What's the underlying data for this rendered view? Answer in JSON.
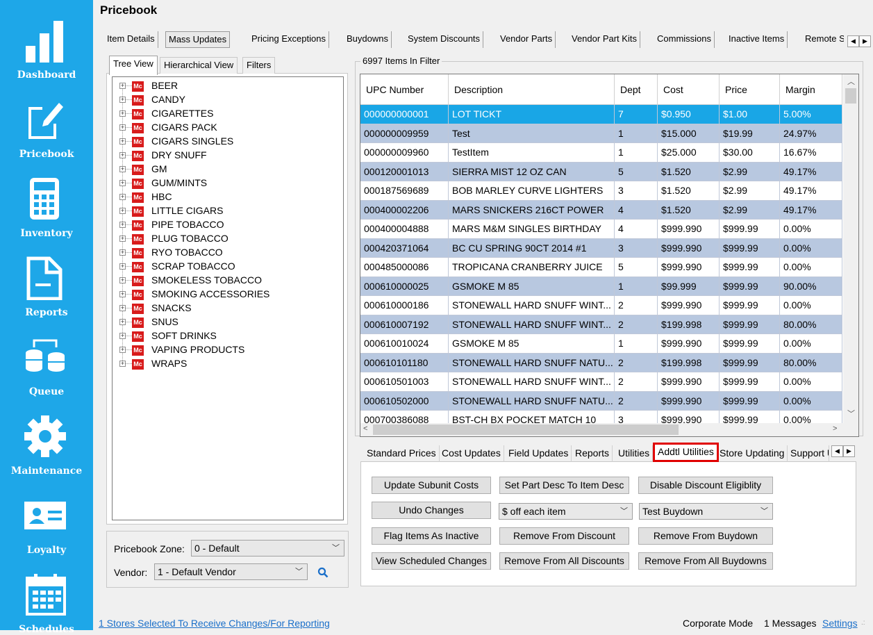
{
  "sidebar": {
    "items": [
      {
        "label": "Dashboard",
        "icon": "bar-chart-icon"
      },
      {
        "label": "Pricebook",
        "icon": "edit-document-icon"
      },
      {
        "label": "Inventory",
        "icon": "calculator-icon"
      },
      {
        "label": "Reports",
        "icon": "report-document-icon"
      },
      {
        "label": "Queue",
        "icon": "database-sync-icon"
      },
      {
        "label": "Maintenance",
        "icon": "gear-icon"
      },
      {
        "label": "Loyalty",
        "icon": "id-card-icon"
      },
      {
        "label": "Schedules",
        "icon": "calendar-icon"
      }
    ],
    "color": "#1ea7e8"
  },
  "page": {
    "title": "Pricebook"
  },
  "top_tabs": [
    "Item Details",
    "Mass Updates",
    "Pricing Exceptions",
    "Buydowns",
    "System Discounts",
    "Vendor Parts",
    "Vendor Part Kits",
    "Commissions",
    "Inactive Items",
    "Remote S"
  ],
  "top_tabs_active": "Mass Updates",
  "left_tabs": [
    "Tree View",
    "Hierarchical View",
    "Filters"
  ],
  "tree_items": [
    "BEER",
    "CANDY",
    "CIGARETTES",
    "CIGARS PACK",
    "CIGARS SINGLES",
    "DRY SNUFF",
    "GM",
    "GUM/MINTS",
    "HBC",
    "LITTLE CIGARS",
    "PIPE TOBACCO",
    "PLUG TOBACCO",
    "RYO TOBACCO",
    "SCRAP TOBACCO",
    "SMOKELESS TOBACCO",
    "SMOKING ACCESSORIES",
    "SNACKS",
    "SNUS",
    "SOFT DRINKS",
    "VAPING PRODUCTS",
    "WRAPS"
  ],
  "tree_badge": "Mc",
  "zone": {
    "zone_label": "Pricebook Zone:",
    "zone_value": "0 - Default",
    "vendor_label": "Vendor:",
    "vendor_value": "1 - Default Vendor"
  },
  "items": {
    "legend": "6997 Items In Filter",
    "columns": [
      "UPC Number",
      "Description",
      "Dept",
      "Cost",
      "Price",
      "Margin"
    ],
    "rows": [
      [
        "000000000001",
        "LOT TICKT",
        "7",
        "$0.950",
        "$1.00",
        "5.00%"
      ],
      [
        "000000009959",
        "Test",
        "1",
        "$15.000",
        "$19.99",
        "24.97%"
      ],
      [
        "000000009960",
        "TestItem",
        "1",
        "$25.000",
        "$30.00",
        "16.67%"
      ],
      [
        "000120001013",
        "SIERRA MIST 12 OZ CAN",
        "5",
        "$1.520",
        "$2.99",
        "49.17%"
      ],
      [
        "000187569689",
        "BOB MARLEY CURVE LIGHTERS",
        "3",
        "$1.520",
        "$2.99",
        "49.17%"
      ],
      [
        "000400002206",
        "MARS SNICKERS 216CT POWER",
        "4",
        "$1.520",
        "$2.99",
        "49.17%"
      ],
      [
        "000400004888",
        "MARS M&M SINGLES BIRTHDAY",
        "4",
        "$999.990",
        "$999.99",
        "0.00%"
      ],
      [
        "000420371064",
        "BC CU SPRING 90CT 2014 #1",
        "3",
        "$999.990",
        "$999.99",
        "0.00%"
      ],
      [
        "000485000086",
        "TROPICANA CRANBERRY JUICE",
        "5",
        "$999.990",
        "$999.99",
        "0.00%"
      ],
      [
        "000610000025",
        "GSMOKE M 85",
        "1",
        "$99.999",
        "$999.99",
        "90.00%"
      ],
      [
        "000610000186",
        "STONEWALL HARD SNUFF WINT...",
        "2",
        "$999.990",
        "$999.99",
        "0.00%"
      ],
      [
        "000610007192",
        "STONEWALL HARD SNUFF WINT...",
        "2",
        "$199.998",
        "$999.99",
        "80.00%"
      ],
      [
        "000610010024",
        "GSMOKE M 85",
        "1",
        "$999.990",
        "$999.99",
        "0.00%"
      ],
      [
        "000610101180",
        "STONEWALL HARD SNUFF NATU...",
        "2",
        "$199.998",
        "$999.99",
        "80.00%"
      ],
      [
        "000610501003",
        "STONEWALL HARD SNUFF WINT...",
        "2",
        "$999.990",
        "$999.99",
        "0.00%"
      ],
      [
        "000610502000",
        "STONEWALL HARD SNUFF NATU...",
        "2",
        "$999.990",
        "$999.99",
        "0.00%"
      ],
      [
        "000700386088",
        "BST-CH BX POCKET MATCH 10",
        "3",
        "$999.990",
        "$999.99",
        "0.00%"
      ]
    ],
    "selected_color": "#19a6e6",
    "alt_color": "#b8c8e0"
  },
  "bottom_tabs": [
    "Standard Prices",
    "Cost Updates",
    "Field Updates",
    "Reports",
    "Utilities",
    "Addtl Utilities",
    "Store Updating",
    "Support U"
  ],
  "bottom_tabs_active": "Addtl Utilities",
  "utilities": {
    "update_subunit_costs": "Update Subunit Costs",
    "set_part_desc": "Set Part Desc To Item Desc",
    "disable_discount": "Disable Discount Eligiblity",
    "undo_changes": "Undo Changes",
    "off_each_item": "$ off each item",
    "test_buydown": "Test Buydown",
    "flag_inactive": "Flag Items As Inactive",
    "remove_from_discount": "Remove From Discount",
    "remove_from_buydown": "Remove From Buydown",
    "view_scheduled": "View Scheduled Changes",
    "remove_all_discounts": "Remove From All Discounts",
    "remove_all_buydowns": "Remove From All Buydowns"
  },
  "status": {
    "stores_link": "1 Stores Selected To Receive Changes/For Reporting",
    "mode": "Corporate Mode",
    "messages": "1 Messages",
    "settings": "Settings"
  }
}
